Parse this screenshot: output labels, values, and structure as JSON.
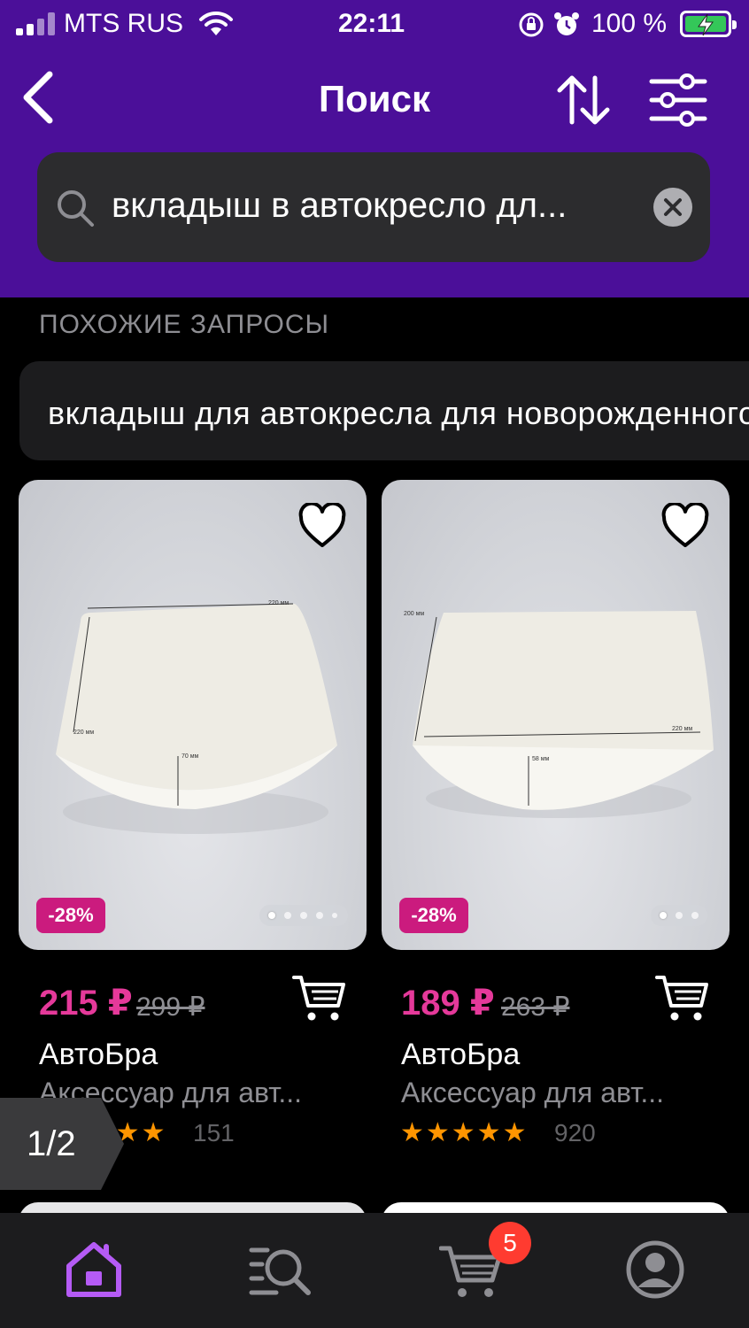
{
  "status_bar": {
    "carrier": "MTS RUS",
    "time": "22:11",
    "battery": "100 %"
  },
  "header": {
    "title": "Поиск",
    "back_icon": "chevron-left-icon",
    "sort_icon": "sort-arrows-icon",
    "filter_icon": "sliders-icon"
  },
  "search": {
    "value": "вкладыш в автокресло дл..."
  },
  "similar": {
    "title": "ПОХОЖИЕ ЗАПРОСЫ",
    "chips": [
      "вкладыш для автокресла для новорожденного"
    ]
  },
  "products": [
    {
      "price": "215 ₽",
      "old_price": "299 ₽",
      "discount": "-28%",
      "brand": "АвтоБра",
      "name": "Аксессуар для авт...",
      "stars": "★★★★★",
      "rating_count": "151",
      "image_labels": [
        "220 мм",
        "220 мм",
        "70 мм"
      ],
      "photos": 5,
      "current_photo": 1
    },
    {
      "price": "189 ₽",
      "old_price": "263 ₽",
      "discount": "-28%",
      "brand": "АвтоБра",
      "name": "Аксессуар для авт...",
      "stars": "★★★★★",
      "rating_count": "920",
      "image_labels": [
        "200 мм",
        "220 мм",
        "58 мм"
      ],
      "photos": 3,
      "current_photo": 1
    }
  ],
  "pager": {
    "label": "1/2"
  },
  "tabbar": {
    "cart_badge": "5",
    "accent": "#b55bf5"
  },
  "colors": {
    "header_bg": "#4b0f99",
    "price": "#e5399a",
    "badge": "#cb1b7e",
    "star": "#ff9500"
  }
}
